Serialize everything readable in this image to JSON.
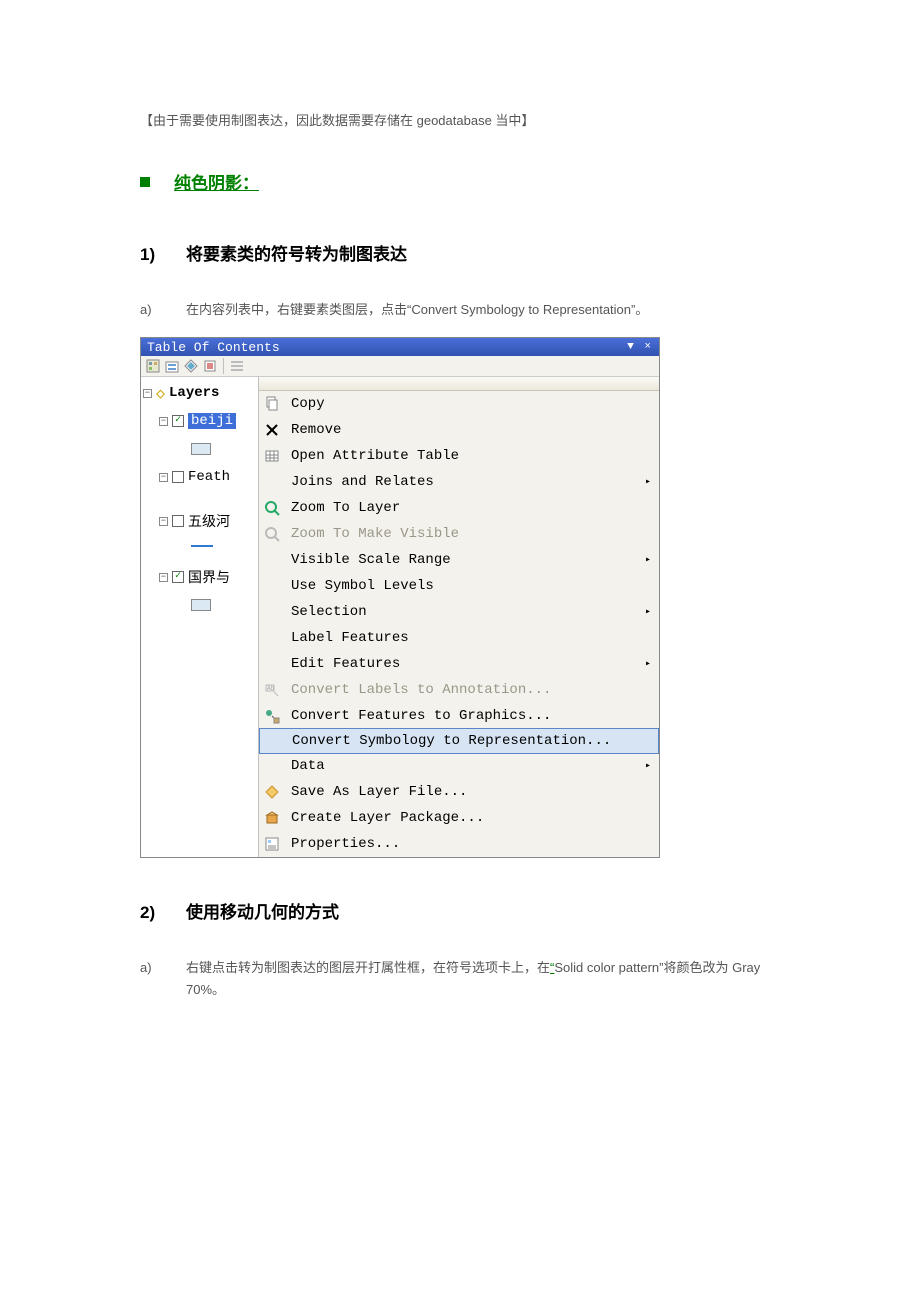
{
  "intro_note": "【由于需要使用制图表达，因此数据需要存储在 geodatabase 当中】",
  "section": {
    "title": "纯色阴影："
  },
  "step1": {
    "num": "1)",
    "title": "将要素类的符号转为制图表达",
    "sub_a_label": "a)",
    "sub_a_text": "在内容列表中，右键要素类图层，点击“Convert Symbology to Representation”。"
  },
  "toc": {
    "title": "Table Of Contents",
    "winbuttons": "▼ ×",
    "layers_label": "Layers",
    "items": [
      {
        "name": "beiji",
        "checked": true,
        "selected": true,
        "symbol": "rect"
      },
      {
        "name": "Feath",
        "checked": false,
        "symbol": "none"
      },
      {
        "name": "五级河",
        "checked": false,
        "symbol": "line"
      },
      {
        "name": "国界与",
        "checked": true,
        "symbol": "rect"
      }
    ]
  },
  "menu": {
    "items": [
      {
        "icon": "copy",
        "label": "Copy"
      },
      {
        "icon": "remove",
        "label": "Remove"
      },
      {
        "icon": "table",
        "label": "Open Attribute Table"
      },
      {
        "icon": "",
        "label": "Joins and Relates",
        "arrow": true
      },
      {
        "icon": "zoom",
        "label": "Zoom To Layer"
      },
      {
        "icon": "zoomgray",
        "label": "Zoom To Make Visible",
        "disabled": true
      },
      {
        "icon": "",
        "label": "Visible Scale Range",
        "arrow": true
      },
      {
        "icon": "",
        "label": "Use Symbol Levels"
      },
      {
        "icon": "",
        "label": "Selection",
        "arrow": true
      },
      {
        "icon": "",
        "label": "Label Features"
      },
      {
        "icon": "",
        "label": "Edit Features",
        "arrow": true
      },
      {
        "icon": "convlabel",
        "label": "Convert Labels to Annotation...",
        "disabled": true
      },
      {
        "icon": "convfeat",
        "label": "Convert Features to Graphics..."
      },
      {
        "icon": "",
        "label": "Convert Symbology to Representation...",
        "highlight": true
      },
      {
        "icon": "",
        "label": "Data",
        "arrow": true
      },
      {
        "icon": "diamond",
        "label": "Save As Layer File..."
      },
      {
        "icon": "pkg",
        "label": "Create Layer Package..."
      },
      {
        "icon": "props",
        "label": "Properties..."
      }
    ]
  },
  "step2": {
    "num": "2)",
    "title": "使用移动几何的方式",
    "sub_a_label": "a)",
    "sub_a_pre": "右键点击转为制图表达的图层开打属性框，在符号选项卡上，在",
    "sub_a_link": "“",
    "sub_a_mid": "Solid color pattern”将颜色改为 Gray 70%。"
  }
}
